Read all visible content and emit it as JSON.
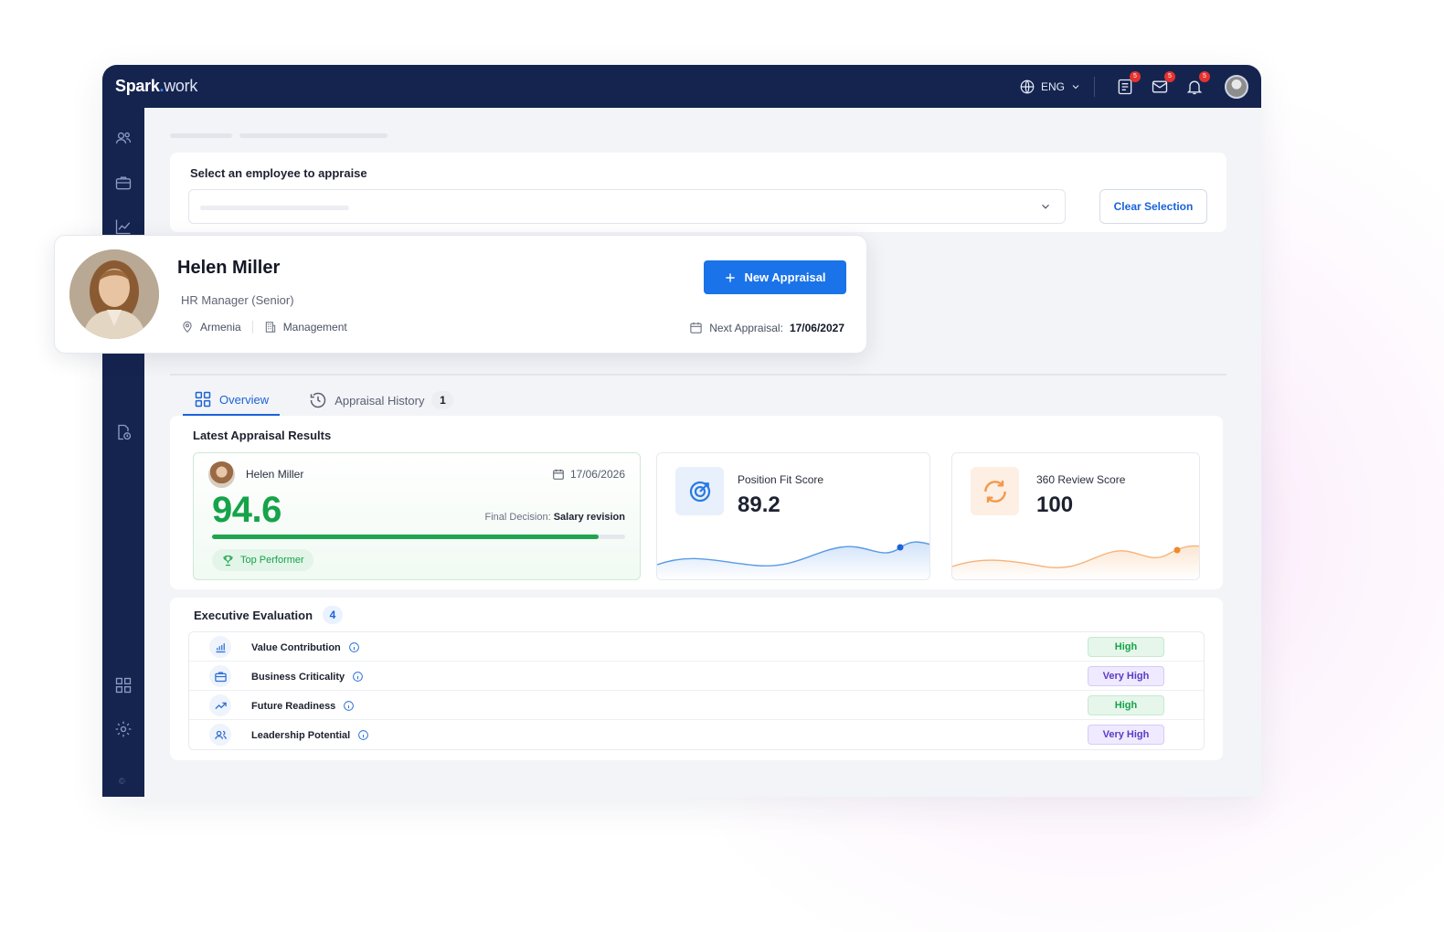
{
  "app": {
    "logo_brand": "Spark",
    "logo_dot": ".",
    "logo_suffix": "work"
  },
  "header": {
    "language": "ENG",
    "badges": {
      "tasks": "5",
      "messages": "5",
      "notifications": "5"
    }
  },
  "selector": {
    "title": "Select an employee to appraise",
    "clear_label": "Clear Selection"
  },
  "profile": {
    "name": "Helen Miller",
    "title": "HR Manager (Senior)",
    "location": "Armenia",
    "department": "Management",
    "new_appraisal_label": "New Appraisal",
    "next_appraisal_label": "Next Appraisal:",
    "next_appraisal_date": "17/06/2027"
  },
  "tabs": [
    {
      "label": "Overview",
      "active": true
    },
    {
      "label": "Appraisal History",
      "count": "1",
      "active": false
    }
  ],
  "latest": {
    "title": "Latest Appraisal Results",
    "employee": "Helen Miller",
    "date": "17/06/2026",
    "score": "94.6",
    "score_progress": 0.936,
    "decision_label": "Final Decision:",
    "decision_value": "Salary revision",
    "badge": "Top Performer"
  },
  "scores": [
    {
      "label": "Position Fit Score",
      "value": "89.2",
      "color": "#2b7be4",
      "icon": "target-icon"
    },
    {
      "label": "360 Review Score",
      "value": "100",
      "color": "#f2994a",
      "icon": "refresh-icon"
    }
  ],
  "executive": {
    "title": "Executive Evaluation",
    "count": "4",
    "rows": [
      {
        "label": "Value Contribution",
        "rating": "High",
        "icon": "bar-chart-icon"
      },
      {
        "label": "Business Criticality",
        "rating": "Very High",
        "icon": "briefcase-icon"
      },
      {
        "label": "Future Readiness",
        "rating": "High",
        "icon": "trending-up-icon"
      },
      {
        "label": "Leadership Potential",
        "rating": "Very High",
        "icon": "users-icon"
      }
    ]
  },
  "colors": {
    "navy": "#15244f",
    "primary": "#1a73e8",
    "success": "#16a34a",
    "purple": "#5b3bc4",
    "orange": "#f2994a"
  },
  "footer": {
    "copyright": "©"
  }
}
